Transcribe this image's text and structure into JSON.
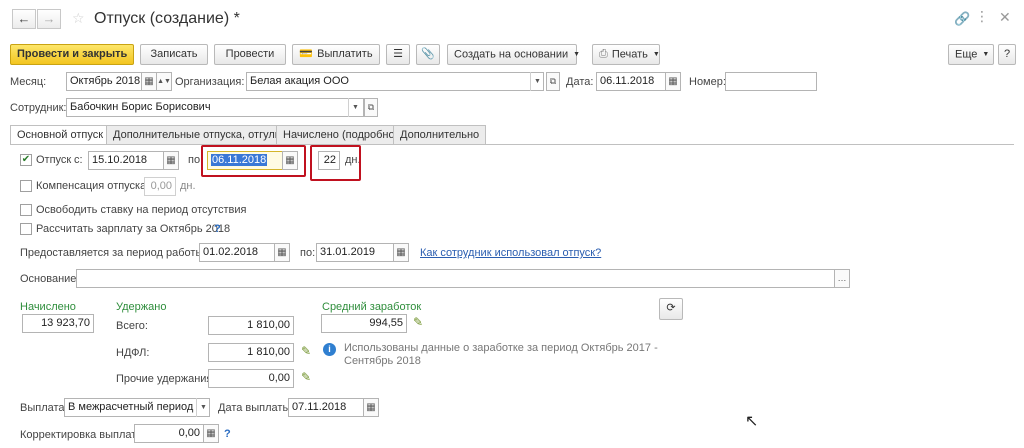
{
  "window": {
    "title": "Отпуск (создание) *"
  },
  "toolbar": {
    "post_close": "Провести и закрыть",
    "save": "Записать",
    "post": "Провести",
    "pay": "Выплатить",
    "create_based": "Создать на основании",
    "print": "Печать",
    "more": "Еще",
    "help": "?"
  },
  "header": {
    "month_label": "Месяц:",
    "month_value": "Октябрь 2018",
    "org_label": "Организация:",
    "org_value": "Белая акация ООО",
    "date_label": "Дата:",
    "date_value": "06.11.2018",
    "number_label": "Номер:",
    "number_value": "",
    "employee_label": "Сотрудник:",
    "employee_value": "Бабочкин Борис Борисович"
  },
  "tabs": [
    {
      "label": "Основной отпуск"
    },
    {
      "label": "Дополнительные отпуска, отгулы"
    },
    {
      "label": "Начислено (подробно)"
    },
    {
      "label": "Дополнительно"
    }
  ],
  "leave": {
    "checkbox_label": "Отпуск",
    "from_label": "с:",
    "from_value": "15.10.2018",
    "to_label": "по:",
    "to_value": "06.11.2018",
    "days_value": "22",
    "days_unit": "дн.",
    "compensation_label": "Компенсация отпуска",
    "compensation_value": "0,00",
    "compensation_unit": "дн.",
    "release_rate_label": "Освободить ставку на период отсутствия",
    "calc_salary_label": "Рассчитать зарплату за Октябрь 2018",
    "calc_salary_help": "?",
    "period_label": "Предоставляется за период работы с:",
    "period_from": "01.02.2018",
    "period_to_label": "по:",
    "period_to": "31.01.2019",
    "used_link": "Как сотрудник использовал отпуск?",
    "basis_label": "Основание:",
    "basis_value": ""
  },
  "totals": {
    "accrued_label": "Начислено",
    "accrued_value": "13 923,70",
    "withheld_label": "Удержано",
    "total_label": "Всего:",
    "total_value": "1 810,00",
    "ndfl_label": "НДФЛ:",
    "ndfl_value": "1 810,00",
    "other_label": "Прочие удержания:",
    "other_value": "0,00",
    "avg_label": "Средний заработок",
    "avg_value": "994,55",
    "info_text_line1": "Использованы данные о заработке за период Октябрь 2017 -",
    "info_text_line2": "Сентябрь 2018"
  },
  "payment": {
    "label": "Выплата:",
    "value": "В межрасчетный период",
    "date_label": "Дата выплаты:",
    "date_value": "07.11.2018",
    "correction_label": "Корректировка выплаты:",
    "correction_value": "0,00",
    "correction_help": "?"
  }
}
